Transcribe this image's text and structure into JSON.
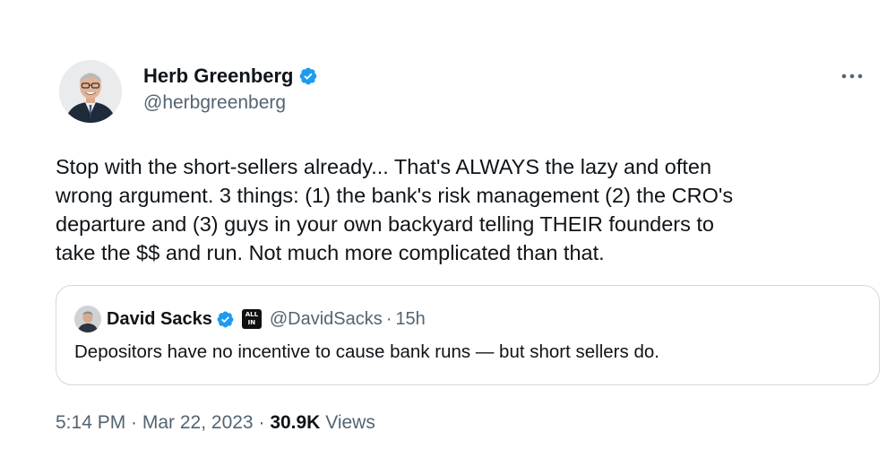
{
  "tweet": {
    "author": {
      "name": "Herb Greenberg",
      "handle": "@herbgreenberg",
      "verified": true
    },
    "text": "Stop with the short-sellers already... That's ALWAYS the lazy and often\nwrong argument. 3 things:  (1) the bank's risk management (2) the CRO's\ndeparture and  (3) guys in your own backyard telling THEIR founders to\ntake the $$ and run. Not much more complicated than that.",
    "more_icon": "more-icon",
    "timestamp": "5:14 PM · Mar 22, 2023",
    "separator": "·",
    "views_count": "30.9K",
    "views_label": "Views"
  },
  "quote": {
    "author": {
      "name": "David Sacks",
      "handle": "@DavidSacks",
      "verified": true,
      "affiliate_badge_text": [
        "ALL",
        "IN"
      ]
    },
    "separator": "·",
    "time": "15h",
    "text": "Depositors have no incentive to cause bank runs — but short sellers do."
  },
  "colors": {
    "verified_blue": "#1d9bf0",
    "secondary_text": "#536471",
    "primary_text": "#0f1419",
    "border": "#cfd9de"
  }
}
